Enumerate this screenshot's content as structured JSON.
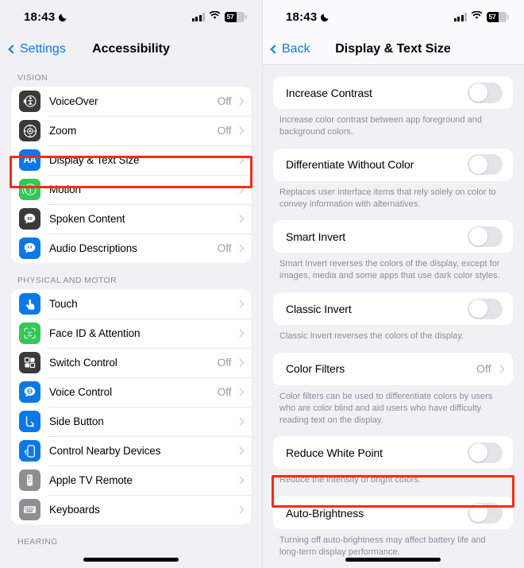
{
  "left": {
    "status": {
      "time": "18:43",
      "moon_icon": "crescent-moon-icon",
      "battery_level": "57"
    },
    "nav": {
      "back_label": "Settings",
      "title": "Accessibility"
    },
    "sections": [
      {
        "header": "VISION",
        "rows": [
          {
            "label": "VoiceOver",
            "value": "Off",
            "icon": "voiceover-icon",
            "icon_color": "#3a3a3c",
            "glyph": "accessibility"
          },
          {
            "label": "Zoom",
            "value": "Off",
            "icon": "zoom-icon",
            "icon_color": "#3a3a3c",
            "glyph": "zoom"
          },
          {
            "label": "Display & Text Size",
            "value": "",
            "icon": "display-text-size-icon",
            "icon_color": "#0a78e7",
            "glyph": "AA"
          },
          {
            "label": "Motion",
            "value": "",
            "icon": "motion-icon",
            "icon_color": "#34c759",
            "glyph": "motion"
          },
          {
            "label": "Spoken Content",
            "value": "",
            "icon": "spoken-content-icon",
            "icon_color": "#3a3a3c",
            "glyph": "speech-60"
          },
          {
            "label": "Audio Descriptions",
            "value": "Off",
            "icon": "audio-descriptions-icon",
            "icon_color": "#0a78e7",
            "glyph": "quote-bubble"
          }
        ]
      },
      {
        "header": "PHYSICAL AND MOTOR",
        "rows": [
          {
            "label": "Touch",
            "value": "",
            "icon": "touch-icon",
            "icon_color": "#0a78e7",
            "glyph": "hand"
          },
          {
            "label": "Face ID & Attention",
            "value": "",
            "icon": "face-id-icon",
            "icon_color": "#34c759",
            "glyph": "face"
          },
          {
            "label": "Switch Control",
            "value": "Off",
            "icon": "switch-control-icon",
            "icon_color": "#3a3a3c",
            "glyph": "grid4"
          },
          {
            "label": "Voice Control",
            "value": "Off",
            "icon": "voice-control-icon",
            "icon_color": "#0a78e7",
            "glyph": "voice-bubble"
          },
          {
            "label": "Side Button",
            "value": "",
            "icon": "side-button-icon",
            "icon_color": "#0a78e7",
            "glyph": "side-button"
          },
          {
            "label": "Control Nearby Devices",
            "value": "",
            "icon": "control-nearby-devices-icon",
            "icon_color": "#0a78e7",
            "glyph": "phone-wave"
          },
          {
            "label": "Apple TV Remote",
            "value": "",
            "icon": "apple-tv-remote-icon",
            "icon_color": "#8e8e93",
            "glyph": "remote"
          },
          {
            "label": "Keyboards",
            "value": "",
            "icon": "keyboards-icon",
            "icon_color": "#8e8e93",
            "glyph": "keyboard"
          }
        ]
      },
      {
        "header": "HEARING",
        "rows": []
      }
    ],
    "highlight": {
      "target": "Display & Text Size",
      "color": "#f12e13"
    }
  },
  "right": {
    "status": {
      "time": "18:43",
      "moon_icon": "crescent-moon-icon",
      "battery_level": "57"
    },
    "nav": {
      "back_label": "Back",
      "title": "Display & Text Size"
    },
    "items": [
      {
        "label": "Increase Contrast",
        "type": "toggle",
        "state": "off",
        "footnote": "Increase color contrast between app foreground and background colors."
      },
      {
        "label": "Differentiate Without Color",
        "type": "toggle",
        "state": "off",
        "footnote": "Replaces user interface items that rely solely on color to convey information with alternatives."
      },
      {
        "label": "Smart Invert",
        "type": "toggle",
        "state": "off",
        "footnote": "Smart Invert reverses the colors of the display, except for images, media and some apps that use dark color styles."
      },
      {
        "label": "Classic Invert",
        "type": "toggle",
        "state": "off",
        "footnote": "Classic Invert reverses the colors of the display."
      },
      {
        "label": "Color Filters",
        "type": "link",
        "value": "Off",
        "footnote": "Color filters can be used to differentiate colors by users who are color blind and aid users who have difficulty reading text on the display."
      },
      {
        "label": "Reduce White Point",
        "type": "toggle",
        "state": "off",
        "footnote": "Reduce the intensity of bright colors."
      },
      {
        "label": "Auto-Brightness",
        "type": "toggle",
        "state": "off",
        "footnote": "Turning off auto-brightness may affect battery life and long-term display performance."
      }
    ],
    "highlight": {
      "target": "Auto-Brightness",
      "color": "#f12e13"
    }
  }
}
